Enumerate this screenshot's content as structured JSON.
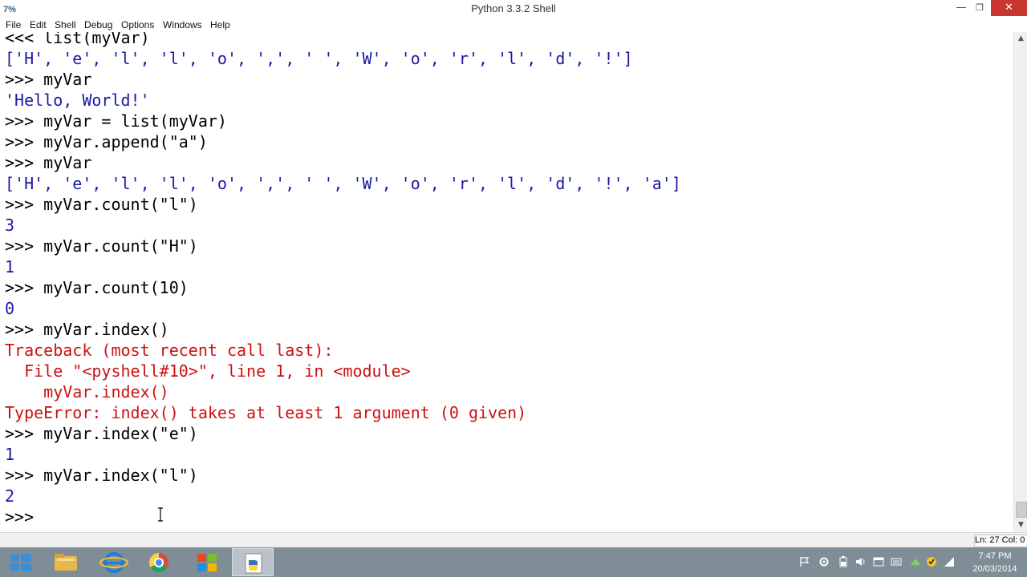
{
  "window": {
    "title": "Python 3.3.2 Shell",
    "icon_label": "7%"
  },
  "menu": [
    "File",
    "Edit",
    "Shell",
    "Debug",
    "Options",
    "Windows",
    "Help"
  ],
  "shell_lines": [
    "<<< list(myVar)",
    "['H', 'e', 'l', 'l', 'o', ',', ' ', 'W', 'o', 'r', 'l', 'd', '!']",
    ">>> myVar",
    "'Hello, World!'",
    ">>> myVar = list(myVar)",
    ">>> myVar.append(\"a\")",
    ">>> myVar",
    "['H', 'e', 'l', 'l', 'o', ',', ' ', 'W', 'o', 'r', 'l', 'd', '!', 'a']",
    ">>> myVar.count(\"l\")",
    "3",
    ">>> myVar.count(\"H\")",
    "1",
    ">>> myVar.count(10)",
    "0",
    ">>> myVar.index()",
    "Traceback (most recent call last):",
    "  File \"<pyshell#10>\", line 1, in <module>",
    "    myVar.index()",
    "TypeError: index() takes at least 1 argument (0 given)",
    ">>> myVar.index(\"e\")",
    "1",
    ">>> myVar.index(\"l\")",
    "2",
    ">>> "
  ],
  "status": {
    "position": "Ln: 27 Col: 0"
  },
  "taskbar": {
    "apps": [
      "start-button",
      "file-explorer-icon",
      "internet-explorer-icon",
      "chrome-icon",
      "office-icon",
      "python-idle-icon"
    ],
    "active_app": "python-idle-icon",
    "clock_time": "7:47 PM",
    "clock_date": "20/03/2014"
  },
  "colors": {
    "prompt_text": "#000000",
    "output_text": "#1a1aa6",
    "error_text": "#cc1111",
    "string_literal": "#0a8a0a",
    "builtin": "#8b008b",
    "taskbar": "#7e8d96",
    "close_button": "#c7372f"
  }
}
